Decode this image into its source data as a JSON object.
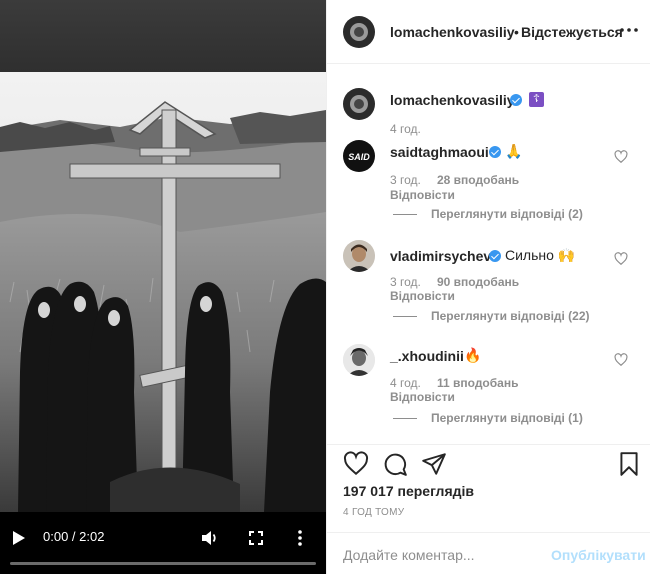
{
  "video": {
    "current_time": "0:00",
    "separator": " / ",
    "duration": "2:02",
    "progress_fraction": 0.0,
    "icons": [
      "play-icon",
      "volume-icon",
      "fullscreen-icon",
      "more-vertical-icon"
    ]
  },
  "header": {
    "username": "lomachenkovasiliy",
    "dot": "•",
    "follow_status": "Відстежується",
    "more_icon": "more-horizontal-icon"
  },
  "caption": {
    "username": "lomachenkovasiliy",
    "emoji": "☦",
    "time": "4 год."
  },
  "comments": [
    {
      "username": "saidtaghmaoui",
      "verified": true,
      "text": "🙏",
      "time": "3 год.",
      "likes": "28 вподобань",
      "reply": "Відповісти",
      "view_replies": "Переглянути відповіді (2)"
    },
    {
      "username": "vladimirsychev",
      "verified": true,
      "text": "Сильно 🙌",
      "time": "3 год.",
      "likes": "90 вподобань",
      "reply": "Відповісти",
      "view_replies": "Переглянути відповіді (22)"
    },
    {
      "username": "_.xhoudinii",
      "verified": false,
      "text": "🔥",
      "time": "4 год.",
      "likes": "11 вподобань",
      "reply": "Відповісти",
      "view_replies": "Переглянути відповіді (1)"
    }
  ],
  "stats": {
    "views": "197 017 переглядів",
    "posted": "4 ГОД ТОМУ"
  },
  "add_comment": {
    "placeholder": "Додайте коментар...",
    "post_label": "Опублікувати"
  },
  "colors": {
    "accent": "#3897f0",
    "post_disabled": "#b2dffc",
    "muted": "#8e8e8e"
  }
}
